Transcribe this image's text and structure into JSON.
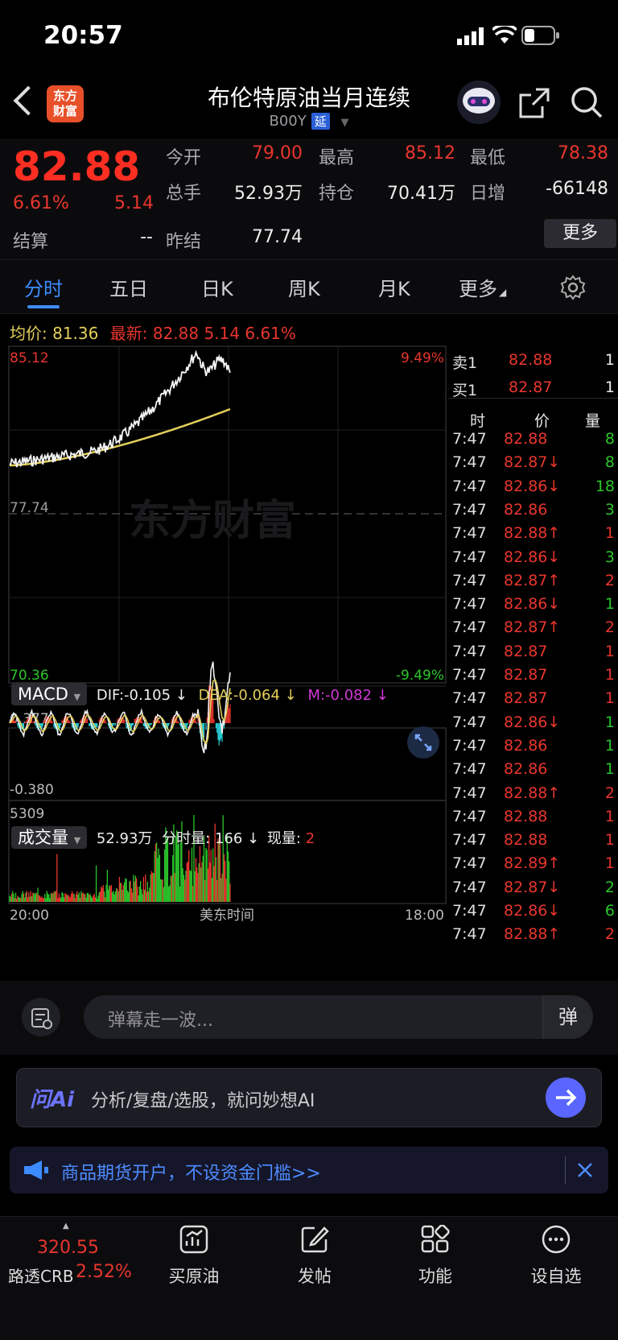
{
  "status_bar": {
    "time": "20:57"
  },
  "header": {
    "brand_line1": "东方",
    "brand_line2": "财富",
    "title": "布伦特原油当月连续",
    "code": "B00Y",
    "delay_badge": "延"
  },
  "quote": {
    "last_price": "82.88",
    "change_pct": "6.61%",
    "change": "5.14",
    "settle_label": "结算",
    "settle_value": "--",
    "fields": [
      {
        "label": "今开",
        "value": "79.00",
        "color": "red"
      },
      {
        "label": "最高",
        "value": "85.12",
        "color": "red"
      },
      {
        "label": "最低",
        "value": "78.38",
        "color": "red"
      },
      {
        "label": "总手",
        "value": "52.93万",
        "color": "white"
      },
      {
        "label": "持仓",
        "value": "70.41万",
        "color": "white"
      },
      {
        "label": "日增",
        "value": "-66148",
        "color": "white"
      },
      {
        "label": "昨结",
        "value": "77.74",
        "color": "white"
      }
    ],
    "more_button": "更多"
  },
  "tabs": [
    "分时",
    "五日",
    "日K",
    "周K",
    "月K",
    "更多"
  ],
  "active_tab": "分时",
  "avg_line": {
    "avg_label": "均价:",
    "avg_value": "81.36",
    "latest_label": "最新:",
    "latest_price": "82.88",
    "latest_change": "5.14",
    "latest_pct": "6.61%"
  },
  "chart_labels": {
    "high": "85.12",
    "high_pct": "9.49%",
    "low": "70.36",
    "low_pct": "-9.49%",
    "prev": "77.74",
    "watermark": "东方财富",
    "x_start": "20:00",
    "x_mid": "美东时间",
    "x_end": "18:00"
  },
  "macd": {
    "selector": "MACD",
    "dif": "DIF:-0.105 ↓",
    "dea": "DEA:-0.064 ↓",
    "m": "M:-0.082 ↓",
    "top": "0.377",
    "bottom": "-0.380"
  },
  "volume": {
    "selector": "成交量",
    "total": "52.93万",
    "minute_label": "分时量:",
    "minute_value": "166 ↓",
    "current_label": "现量:",
    "current_value": "2",
    "max": "5309"
  },
  "order_book": {
    "ask_label": "卖1",
    "ask_price": "82.88",
    "ask_qty": "1",
    "bid_label": "买1",
    "bid_price": "82.87",
    "bid_qty": "1",
    "col_time": "时",
    "col_price": "价",
    "col_qty": "量",
    "trades": [
      {
        "t": "7:47",
        "p": "82.88",
        "q": "8",
        "pc": "red",
        "qc": "green"
      },
      {
        "t": "7:47",
        "p": "82.87↓",
        "q": "8",
        "pc": "red",
        "qc": "green"
      },
      {
        "t": "7:47",
        "p": "82.86↓",
        "q": "18",
        "pc": "red",
        "qc": "green"
      },
      {
        "t": "7:47",
        "p": "82.86",
        "q": "3",
        "pc": "red",
        "qc": "green"
      },
      {
        "t": "7:47",
        "p": "82.88↑",
        "q": "1",
        "pc": "red",
        "qc": "red"
      },
      {
        "t": "7:47",
        "p": "82.86↓",
        "q": "3",
        "pc": "red",
        "qc": "green"
      },
      {
        "t": "7:47",
        "p": "82.87↑",
        "q": "2",
        "pc": "red",
        "qc": "red"
      },
      {
        "t": "7:47",
        "p": "82.86↓",
        "q": "1",
        "pc": "red",
        "qc": "green"
      },
      {
        "t": "7:47",
        "p": "82.87↑",
        "q": "2",
        "pc": "red",
        "qc": "red"
      },
      {
        "t": "7:47",
        "p": "82.87",
        "q": "1",
        "pc": "red",
        "qc": "red"
      },
      {
        "t": "7:47",
        "p": "82.87",
        "q": "1",
        "pc": "red",
        "qc": "red"
      },
      {
        "t": "7:47",
        "p": "82.87",
        "q": "1",
        "pc": "red",
        "qc": "red"
      },
      {
        "t": "7:47",
        "p": "82.86↓",
        "q": "1",
        "pc": "red",
        "qc": "green"
      },
      {
        "t": "7:47",
        "p": "82.86",
        "q": "1",
        "pc": "red",
        "qc": "green"
      },
      {
        "t": "7:47",
        "p": "82.86",
        "q": "1",
        "pc": "red",
        "qc": "green"
      },
      {
        "t": "7:47",
        "p": "82.88↑",
        "q": "2",
        "pc": "red",
        "qc": "red"
      },
      {
        "t": "7:47",
        "p": "82.88",
        "q": "1",
        "pc": "red",
        "qc": "red"
      },
      {
        "t": "7:47",
        "p": "82.88",
        "q": "1",
        "pc": "red",
        "qc": "red"
      },
      {
        "t": "7:47",
        "p": "82.89↑",
        "q": "1",
        "pc": "red",
        "qc": "red"
      },
      {
        "t": "7:47",
        "p": "82.87↓",
        "q": "2",
        "pc": "red",
        "qc": "green"
      },
      {
        "t": "7:47",
        "p": "82.86↓",
        "q": "6",
        "pc": "red",
        "qc": "green"
      },
      {
        "t": "7:47",
        "p": "82.88↑",
        "q": "2",
        "pc": "red",
        "qc": "red"
      }
    ]
  },
  "comment": {
    "placeholder": "弹幕走一波...",
    "danmu_btn": "弹"
  },
  "ai": {
    "logo": "问Ai",
    "text": "分析/复盘/选股，就问妙想AI"
  },
  "ad": {
    "text": "商品期货开户，不设资金门槛>>"
  },
  "tabbar": {
    "index_value": "320.55",
    "index_name": "路透CRB",
    "index_pct": "2.52%",
    "items": [
      "买原油",
      "发帖",
      "功能",
      "设自选"
    ]
  },
  "colors": {
    "red": "#e8362e",
    "green": "#2bc52b",
    "yellow": "#e3cf5a",
    "accent": "#3d8cff"
  }
}
